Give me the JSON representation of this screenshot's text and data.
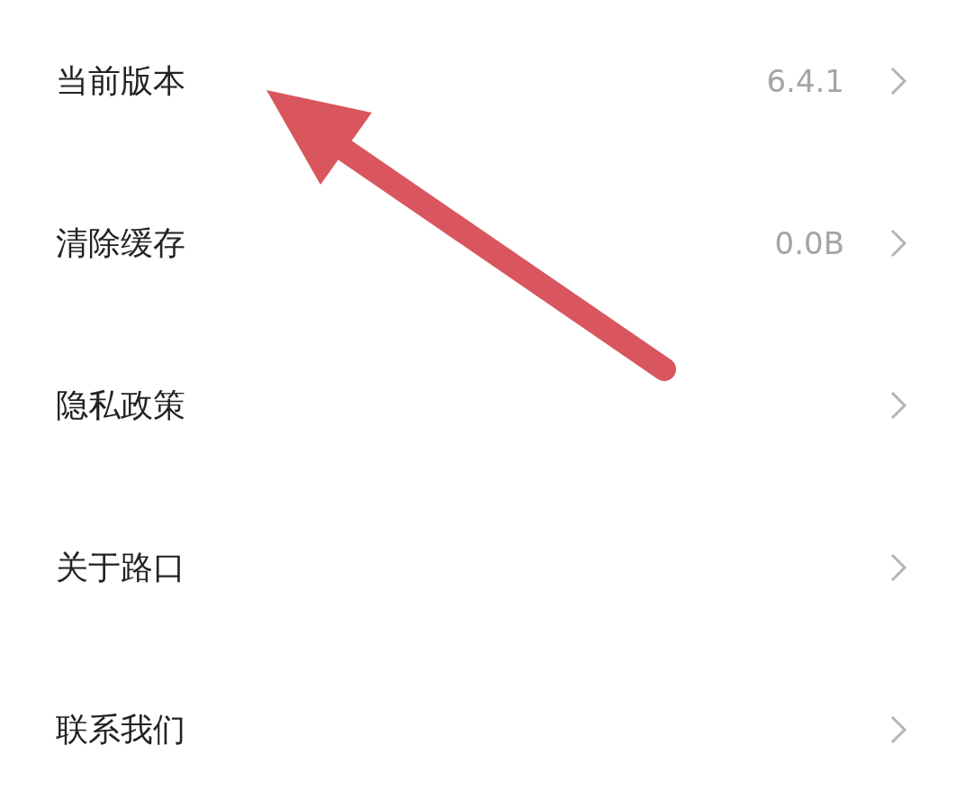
{
  "settings": [
    {
      "label": "当前版本",
      "value": "6.4.1"
    },
    {
      "label": "清除缓存",
      "value": "0.0B"
    },
    {
      "label": "隐私政策"
    },
    {
      "label": "关于路口"
    },
    {
      "label": "联系我们"
    }
  ],
  "annotation": {
    "kind": "arrow"
  }
}
